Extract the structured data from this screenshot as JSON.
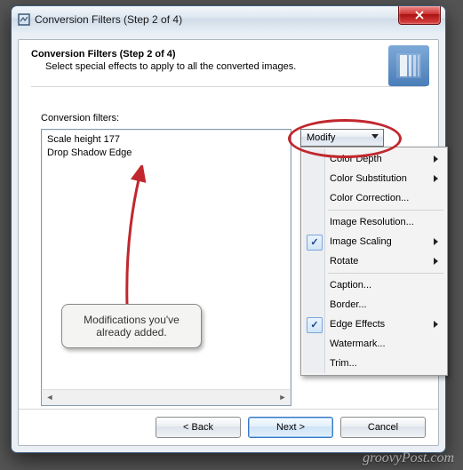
{
  "window": {
    "title": "Conversion Filters (Step 2 of 4)"
  },
  "header": {
    "title": "Conversion Filters (Step 2 of 4)",
    "subtitle": "Select special effects to apply to all the converted images."
  },
  "filters": {
    "label": "Conversion filters:",
    "items": [
      "Scale height 177",
      "Drop Shadow Edge"
    ]
  },
  "dropdown": {
    "label": "Modify"
  },
  "menu": [
    {
      "label": "Color Depth",
      "submenu": true,
      "checked": false
    },
    {
      "label": "Color Substitution",
      "submenu": true,
      "checked": false
    },
    {
      "label": "Color Correction...",
      "submenu": false,
      "checked": false
    },
    {
      "sep": true
    },
    {
      "label": "Image Resolution...",
      "submenu": false,
      "checked": false
    },
    {
      "label": "Image Scaling",
      "submenu": true,
      "checked": true
    },
    {
      "label": "Rotate",
      "submenu": true,
      "checked": false
    },
    {
      "sep": true
    },
    {
      "label": "Caption...",
      "submenu": false,
      "checked": false
    },
    {
      "label": "Border...",
      "submenu": false,
      "checked": false
    },
    {
      "label": "Edge Effects",
      "submenu": true,
      "checked": true
    },
    {
      "label": "Watermark...",
      "submenu": false,
      "checked": false
    },
    {
      "label": "Trim...",
      "submenu": false,
      "checked": false
    }
  ],
  "callout": {
    "line1": "Modifications you've",
    "line2": "already added."
  },
  "buttons": {
    "back": "< Back",
    "next": "Next >",
    "cancel": "Cancel"
  },
  "watermark": "groovyPost.com"
}
